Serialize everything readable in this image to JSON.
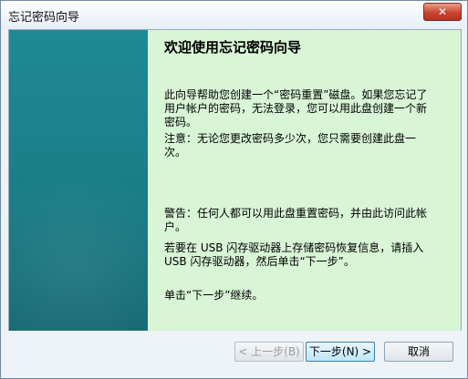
{
  "window": {
    "title": "忘记密码向导",
    "close_label": "✕"
  },
  "content": {
    "heading": "欢迎使用忘记密码向导",
    "para1": "此向导帮助您创建一个“密码重置”磁盘。如果您忘记了用户帐户的密码，无法登录，您可以用此盘创建一个新密码。",
    "para2": "注意：无论您更改密码多少次，您只需要创建此盘一次。",
    "warning": "警告：任何人都可以用此盘重置密码，并由此访问此帐户。",
    "usb_note": "若要在 USB 闪存驱动器上存储密码恢复信息，请插入 USB 闪存驱动器，然后单击“下一步”。",
    "continue": "单击“下一步”继续。"
  },
  "buttons": {
    "back": "< 上一步(B)",
    "next": "下一步(N) >",
    "cancel": "取消"
  }
}
